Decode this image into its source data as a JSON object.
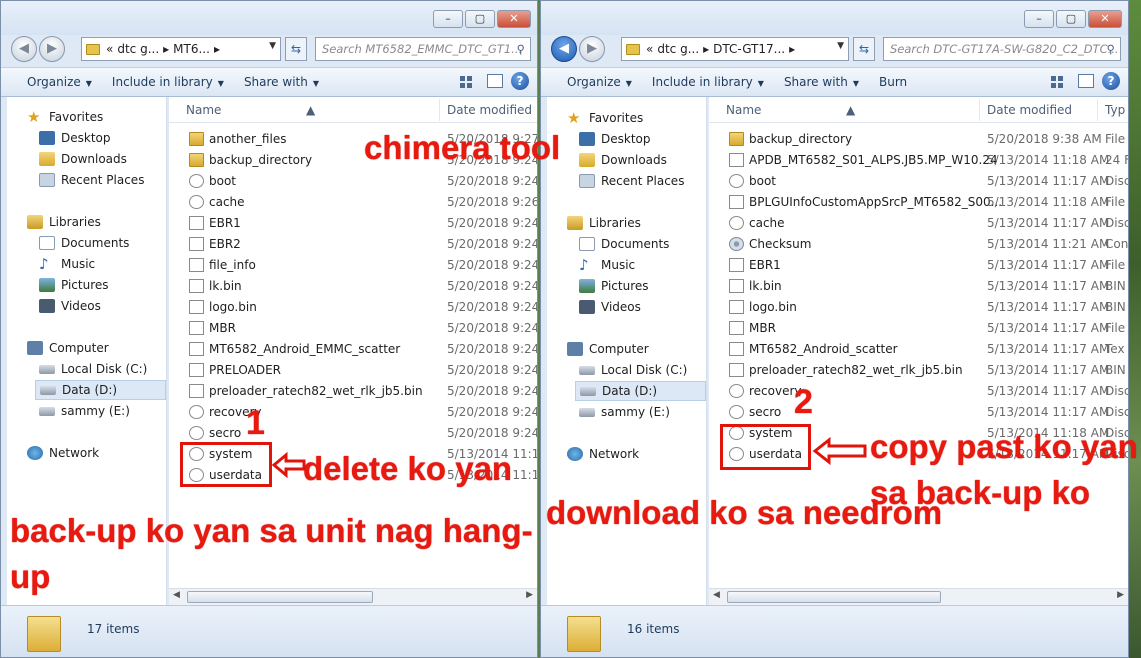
{
  "left_window": {
    "address": {
      "prefix": "«",
      "crumbs": [
        "dtc g...",
        "MT6..."
      ]
    },
    "search_placeholder": "Search MT6582_EMMC_DTC_GT1...",
    "toolbar": [
      {
        "label": "Organize"
      },
      {
        "label": "Include in library"
      },
      {
        "label": "Share with"
      }
    ],
    "nav": {
      "favorites": "Favorites",
      "desktop": "Desktop",
      "downloads": "Downloads",
      "recent": "Recent Places",
      "libraries": "Libraries",
      "documents": "Documents",
      "music": "Music",
      "pictures": "Pictures",
      "videos": "Videos",
      "computer": "Computer",
      "local_disk": "Local Disk (C:)",
      "data_disk": "Data (D:)",
      "sammy": "sammy (E:)",
      "network": "Network"
    },
    "columns": {
      "name": "Name",
      "date": "Date modified"
    },
    "files": [
      {
        "name": "another_files",
        "date": "5/20/2018 9:27 A",
        "icon": "folder-icon"
      },
      {
        "name": "backup_directory",
        "date": "5/20/2018 9:24 A",
        "icon": "folder-icon"
      },
      {
        "name": "boot",
        "date": "5/20/2018 9:24 A",
        "icon": "system-file-icon"
      },
      {
        "name": "cache",
        "date": "5/20/2018 9:26 A",
        "icon": "system-file-icon"
      },
      {
        "name": "EBR1",
        "date": "5/20/2018 9:24 A",
        "icon": "file-icon"
      },
      {
        "name": "EBR2",
        "date": "5/20/2018 9:24 A",
        "icon": "file-icon"
      },
      {
        "name": "file_info",
        "date": "5/20/2018 9:24 A",
        "icon": "file-icon"
      },
      {
        "name": "lk.bin",
        "date": "5/20/2018 9:24 A",
        "icon": "file-icon"
      },
      {
        "name": "logo.bin",
        "date": "5/20/2018 9:24 A",
        "icon": "file-icon"
      },
      {
        "name": "MBR",
        "date": "5/20/2018 9:24 A",
        "icon": "file-icon"
      },
      {
        "name": "MT6582_Android_EMMC_scatter",
        "date": "5/20/2018 9:24 A",
        "icon": "file-icon"
      },
      {
        "name": "PRELOADER",
        "date": "5/20/2018 9:24 A",
        "icon": "file-icon"
      },
      {
        "name": "preloader_ratech82_wet_rlk_jb5.bin",
        "date": "5/20/2018 9:24 A",
        "icon": "file-icon"
      },
      {
        "name": "recovery",
        "date": "5/20/2018 9:24 A",
        "icon": "system-file-icon"
      },
      {
        "name": "secro",
        "date": "5/20/2018 9:24 A",
        "icon": "system-file-icon"
      },
      {
        "name": "system",
        "date": "5/13/2014 11:18",
        "icon": "system-file-icon"
      },
      {
        "name": "userdata",
        "date": "5/13/2014 11:18",
        "icon": "system-file-icon"
      }
    ],
    "status": "17 items"
  },
  "right_window": {
    "address": {
      "prefix": "«",
      "crumbs": [
        "dtc g...",
        "DTC-GT17..."
      ]
    },
    "search_placeholder": "Search DTC-GT17A-SW-G820_C2_DTC...",
    "toolbar": [
      {
        "label": "Organize"
      },
      {
        "label": "Include in library"
      },
      {
        "label": "Share with"
      },
      {
        "label": "Burn"
      }
    ],
    "nav": {
      "favorites": "Favorites",
      "desktop": "Desktop",
      "downloads": "Downloads",
      "recent": "Recent Places",
      "libraries": "Libraries",
      "documents": "Documents",
      "music": "Music",
      "pictures": "Pictures",
      "videos": "Videos",
      "computer": "Computer",
      "local_disk": "Local Disk (C:)",
      "data_disk": "Data (D:)",
      "sammy": "sammy (E:)",
      "network": "Network"
    },
    "columns": {
      "name": "Name",
      "date": "Date modified",
      "type": "Typ"
    },
    "files": [
      {
        "name": "backup_directory",
        "date": "5/20/2018 9:38 AM",
        "type": "File",
        "icon": "folder-icon"
      },
      {
        "name": "APDB_MT6582_S01_ALPS.JB5.MP_W10.24",
        "date": "5/13/2014 11:18 AM",
        "type": "24 F",
        "icon": "file-icon"
      },
      {
        "name": "boot",
        "date": "5/13/2014 11:17 AM",
        "type": "Disc",
        "icon": "system-file-icon"
      },
      {
        "name": "BPLGUInfoCustomAppSrcP_MT6582_S00...",
        "date": "5/13/2014 11:18 AM",
        "type": "File",
        "icon": "file-icon"
      },
      {
        "name": "cache",
        "date": "5/13/2014 11:17 AM",
        "type": "Disc",
        "icon": "system-file-icon"
      },
      {
        "name": "Checksum",
        "date": "5/13/2014 11:21 AM",
        "type": "Con",
        "icon": "gear-icon"
      },
      {
        "name": "EBR1",
        "date": "5/13/2014 11:17 AM",
        "type": "File",
        "icon": "file-icon"
      },
      {
        "name": "lk.bin",
        "date": "5/13/2014 11:17 AM",
        "type": "BIN",
        "icon": "file-icon"
      },
      {
        "name": "logo.bin",
        "date": "5/13/2014 11:17 AM",
        "type": "BIN",
        "icon": "file-icon"
      },
      {
        "name": "MBR",
        "date": "5/13/2014 11:17 AM",
        "type": "File",
        "icon": "file-icon"
      },
      {
        "name": "MT6582_Android_scatter",
        "date": "5/13/2014 11:17 AM",
        "type": "Tex",
        "icon": "file-icon"
      },
      {
        "name": "preloader_ratech82_wet_rlk_jb5.bin",
        "date": "5/13/2014 11:17 AM",
        "type": "BIN",
        "icon": "file-icon"
      },
      {
        "name": "recovery",
        "date": "5/13/2014 11:17 AM",
        "type": "Disc",
        "icon": "system-file-icon"
      },
      {
        "name": "secro",
        "date": "5/13/2014 11:17 AM",
        "type": "Disc",
        "icon": "system-file-icon"
      },
      {
        "name": "system",
        "date": "5/13/2014 11:18 AM",
        "type": "Disc",
        "icon": "system-file-icon"
      },
      {
        "name": "userdata",
        "date": "5/13/2014 11:17 AM",
        "type": "Disc",
        "icon": "system-file-icon"
      }
    ],
    "status": "16 items"
  },
  "annotations": {
    "chimera": "chimera tool",
    "step1": "1",
    "delete": "delete ko yan",
    "backup_line1": "back-up ko yan sa unit nag hang-",
    "backup_line2": "up",
    "download": "download ko sa needrom",
    "step2": "2",
    "copy_line1": "copy past ko yan",
    "copy_line2": "sa back-up ko"
  },
  "colors": {
    "annotation": "#e8190e",
    "accent": "#1f5ab3"
  }
}
